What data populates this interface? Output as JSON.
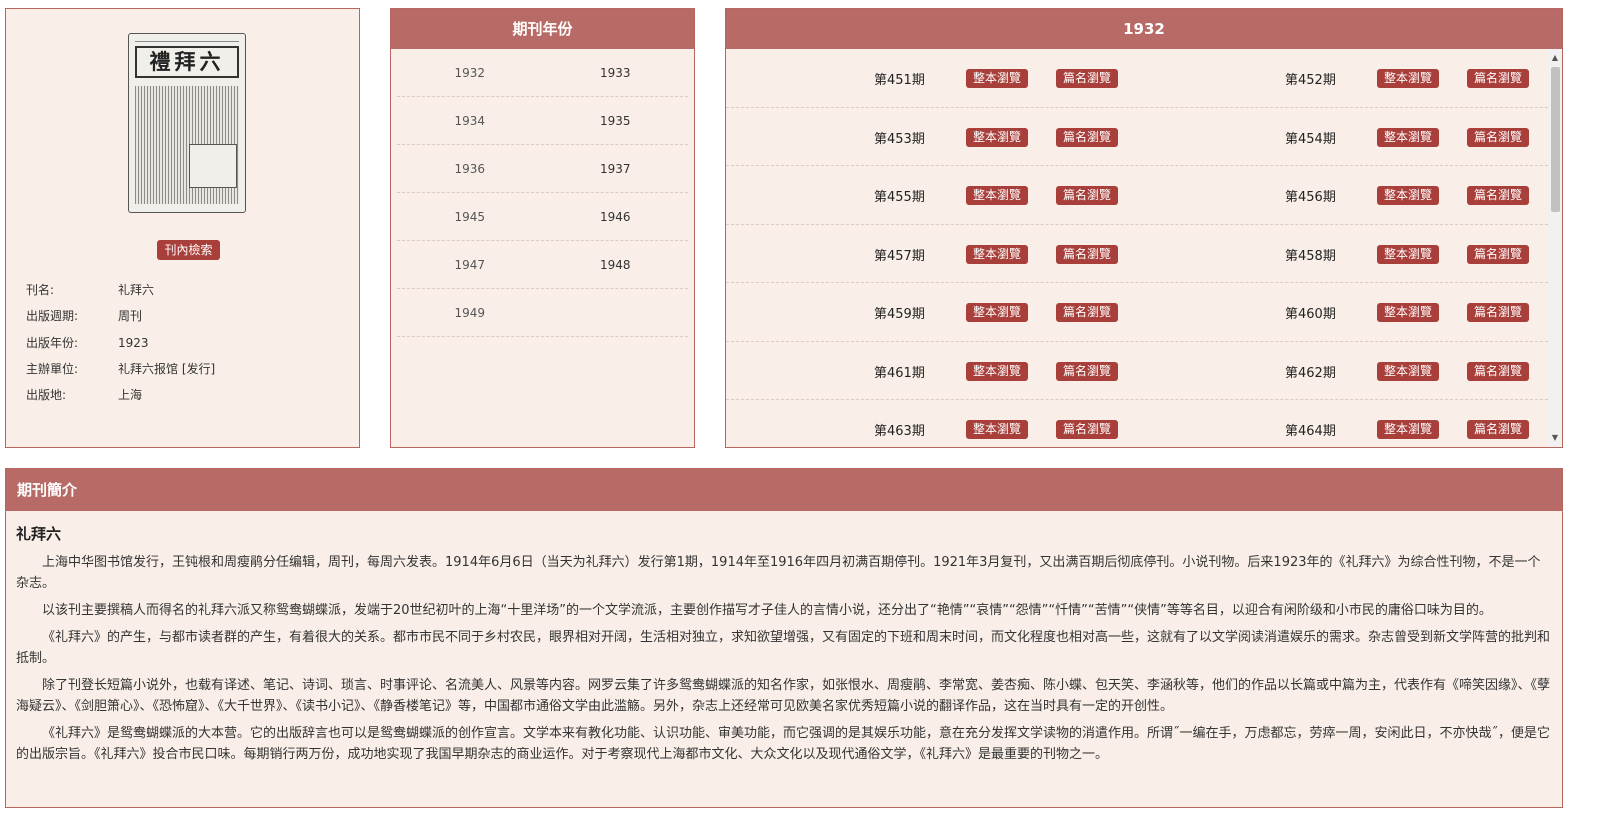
{
  "info": {
    "cover_masthead": "禮拜六",
    "search_label": "刊內檢索",
    "fields": [
      {
        "key": "刊名:",
        "value": "礼拜六"
      },
      {
        "key": "出版週期:",
        "value": "周刊"
      },
      {
        "key": "出版年份:",
        "value": "1923"
      },
      {
        "key": "主辦單位:",
        "value": "礼拜六报馆 [发行]"
      },
      {
        "key": "出版地:",
        "value": "上海"
      }
    ]
  },
  "years": {
    "title": "期刊年份",
    "rows": [
      [
        "1932",
        "1933"
      ],
      [
        "1934",
        "1935"
      ],
      [
        "1936",
        "1937"
      ],
      [
        "1945",
        "1946"
      ],
      [
        "1947",
        "1948"
      ],
      [
        "1949",
        ""
      ]
    ]
  },
  "issues": {
    "title": "1932",
    "full_label": "整本瀏覽",
    "article_label": "篇名瀏覽",
    "rows": [
      [
        "第451期",
        "第452期"
      ],
      [
        "第453期",
        "第454期"
      ],
      [
        "第455期",
        "第456期"
      ],
      [
        "第457期",
        "第458期"
      ],
      [
        "第459期",
        "第460期"
      ],
      [
        "第461期",
        "第462期"
      ],
      [
        "第463期",
        "第464期"
      ]
    ]
  },
  "intro": {
    "heading": "期刊簡介",
    "title": "礼拜六",
    "paragraphs": [
      "上海中华图书馆发行，王钝根和周瘦鹃分任编辑，周刊，每周六发表。1914年6月6日（当天为礼拜六）发行第1期，1914年至1916年四月初满百期停刊。1921年3月复刊，又出满百期后彻底停刊。小说刊物。后来1923年的《礼拜六》为综合性刊物，不是一个杂志。",
      "以该刊主要撰稿人而得名的礼拜六派又称鸳鸯蝴蝶派，发端于20世纪初叶的上海“十里洋场”的一个文学流派，主要创作描写才子佳人的言情小说，还分出了“艳情”“哀情”“怨情”“忏情”“苦情”“侠情”等等名目，以迎合有闲阶级和小市民的庸俗口味为目的。",
      "《礼拜六》的产生，与都市读者群的产生，有着很大的关系。都市市民不同于乡村农民，眼界相对开阔，生活相对独立，求知欲望增强，又有固定的下班和周末时间，而文化程度也相对高一些，这就有了以文学阅读消遣娱乐的需求。杂志曾受到新文学阵营的批判和抵制。",
      "除了刊登长短篇小说外，也载有译述、笔记、诗词、琐言、时事评论、名流美人、风景等内容。网罗云集了许多鸳鸯蝴蝶派的知名作家，如张恨水、周瘦鹃、李常宽、姜杏痴、陈小蝶、包天笑、李涵秋等，他们的作品以长篇或中篇为主，代表作有《啼笑因缘》、《孽海疑云》、《剑胆箫心》、《恐怖窟》、《大千世界》、《读书小记》、《静香楼笔记》等，中国都市通俗文学由此滥觞。另外，杂志上还经常可见欧美名家优秀短篇小说的翻译作品，这在当时具有一定的开创性。",
      "《礼拜六》是鸳鸯蝴蝶派的大本营。它的出版辞言也可以是鸳鸯蝴蝶派的创作宣言。文学本来有教化功能、认识功能、审美功能，而它强调的是其娱乐功能，意在充分发挥文学读物的消遣作用。所谓˝一编在手，万虑都忘，劳瘁一周，安闲此日，不亦快哉˝，便是它的出版宗旨。《礼拜六》投合市民口味。每期销行两万份，成功地实现了我国早期杂志的商业运作。对于考察现代上海都市文化、大众文化以及现代通俗文学，《礼拜六》是最重要的刊物之一。"
    ]
  }
}
